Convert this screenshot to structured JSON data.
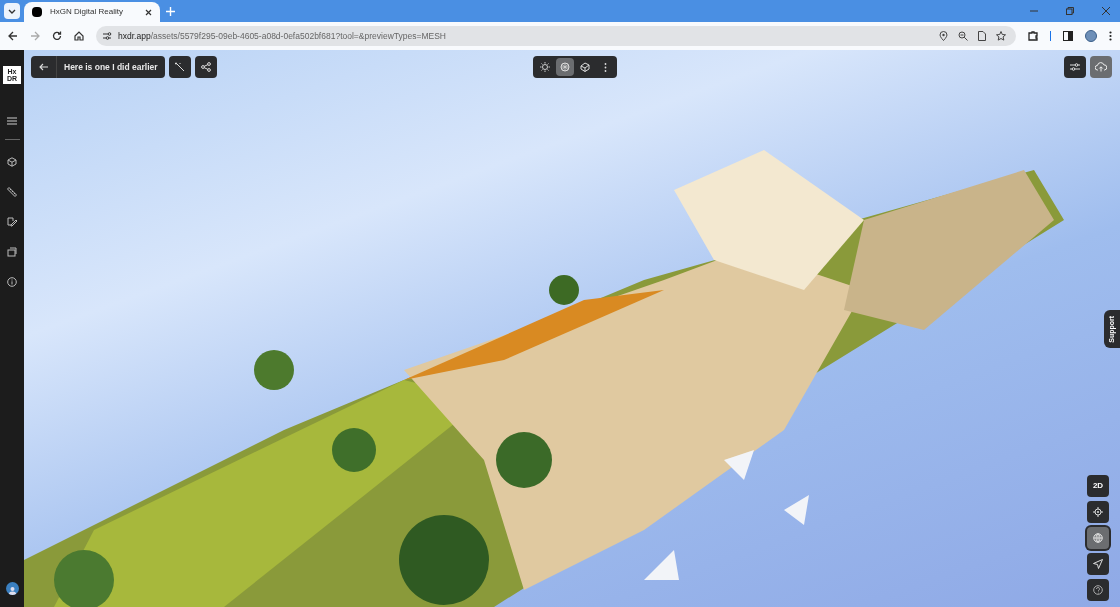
{
  "browser": {
    "tab_title": "HxGN Digital Reality",
    "url": "**hxdr.app**/assets/5579f295-09eb-4605-a08d-0efa502bf681?tool=&previewTypes=MESH"
  },
  "sidebar": {
    "logo": "Hx DR"
  },
  "header": {
    "title": "Here is one I did earlier"
  },
  "view_modes": [
    {
      "kind": "sun",
      "selected": false
    },
    {
      "kind": "sphere",
      "selected": true
    },
    {
      "kind": "box",
      "selected": false
    }
  ],
  "map_controls": [
    {
      "kind": "text",
      "label": "2D",
      "selected": false
    },
    {
      "kind": "locate",
      "selected": false
    },
    {
      "kind": "globe",
      "selected": true
    },
    {
      "kind": "navigate",
      "selected": false
    },
    {
      "kind": "help",
      "selected": false
    }
  ],
  "support_tab": "Support"
}
